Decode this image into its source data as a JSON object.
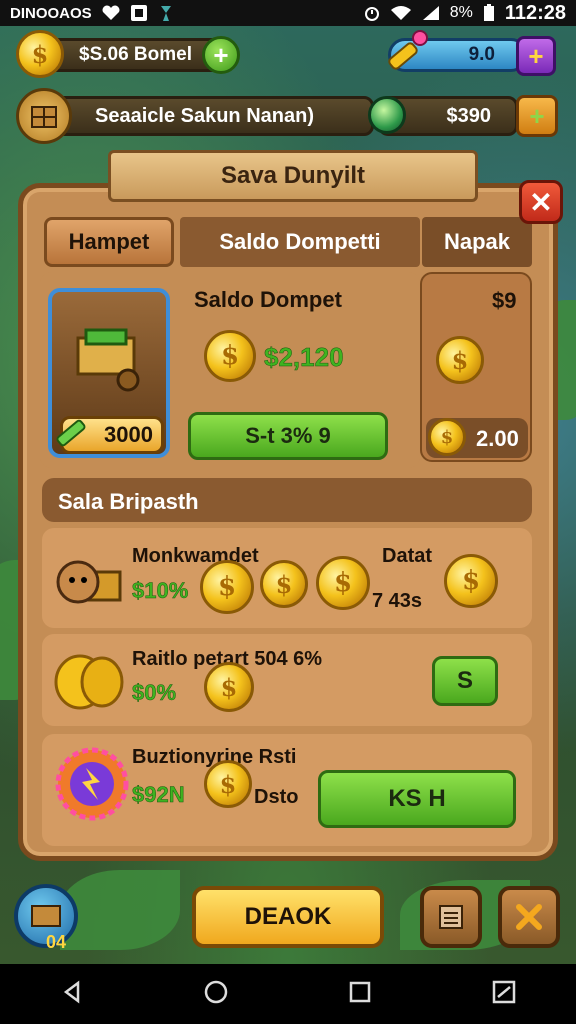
{
  "status_bar": {
    "carrier": "DINOOAOS",
    "battery": "8%",
    "time": "112:28"
  },
  "top_bar": {
    "coins_label": "$S.06 Bomel",
    "gems_value": "9.0",
    "chest_label": "Seaaicle Sakun Nanan)",
    "chest_value": "$390"
  },
  "panel": {
    "title": "Sava Dunyilt",
    "close_symbol": "✕",
    "tabs": [
      "Hampet",
      "Saldo Dompetti",
      "Napak"
    ],
    "wallet": {
      "item_count": "3000",
      "heading": "Saldo Dompet",
      "amount": "$2,120",
      "button_label": "S-t 3% 9",
      "side_value_top": "$9",
      "side_value_bottom": "2.00"
    },
    "subheading": "Sala Bripasth",
    "rows": [
      {
        "title": "Monkwamdet",
        "green_value": "$10%",
        "extra_label": "Datat",
        "extra_value": "7 43s"
      },
      {
        "title": "Raitlo petart 504 6%",
        "green_value": "$0%",
        "button_label": "S"
      },
      {
        "title": "Buztionyrine Rsti",
        "green_value": "$92N",
        "extra_label": "Dsto",
        "button_label": "KS H"
      }
    ]
  },
  "bottom": {
    "level_badge": "04",
    "main_button": "DEAOK"
  },
  "colors": {
    "gold": "#f4c21c",
    "green_button": "#5ec02a",
    "panel_wood": "#c48d55",
    "close_red": "#d8361f"
  }
}
